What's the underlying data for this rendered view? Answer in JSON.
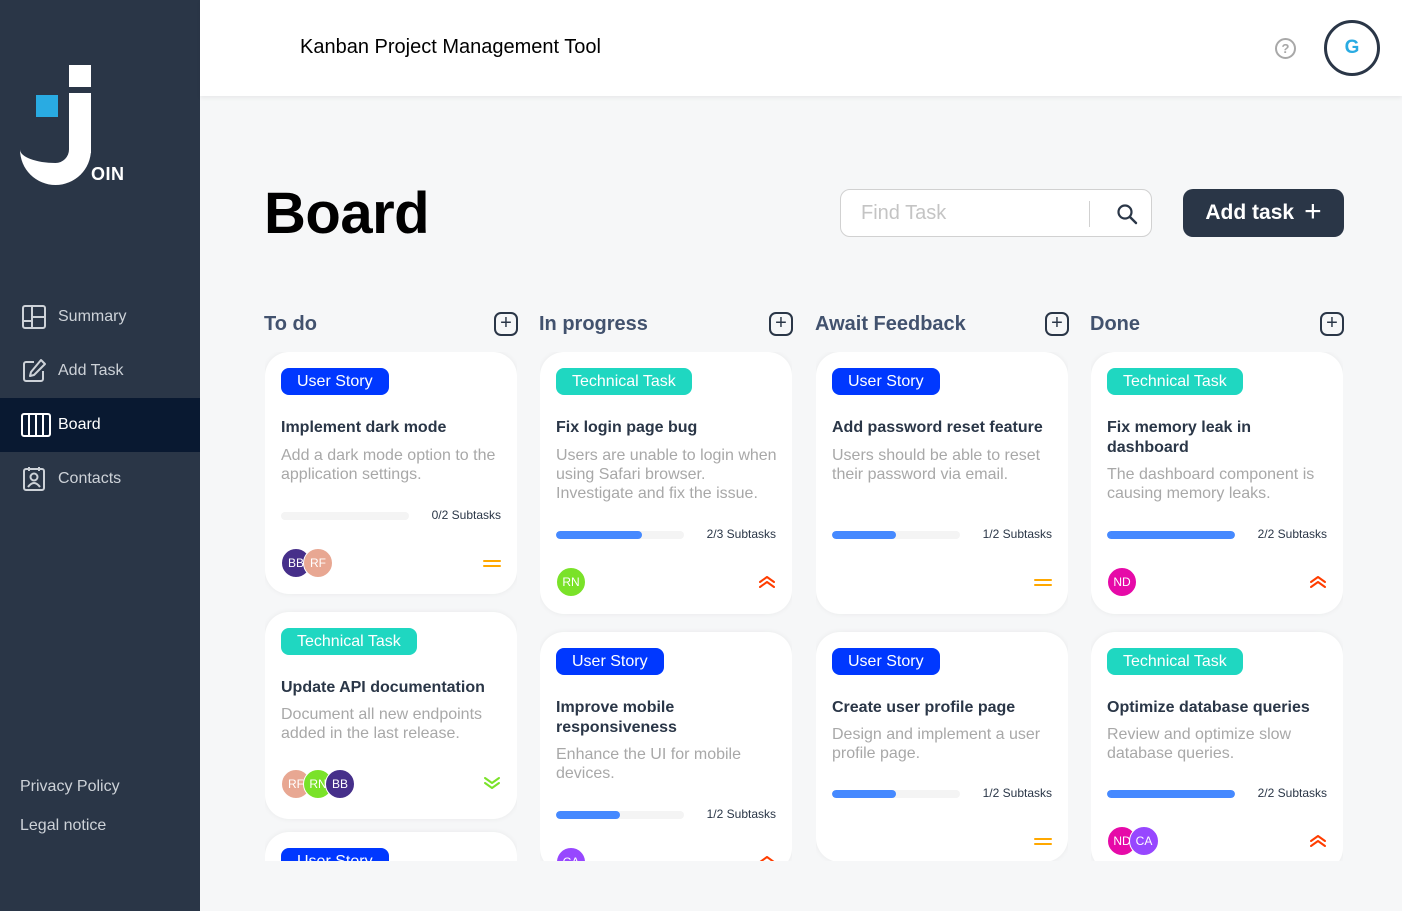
{
  "app": {
    "logo_text": "OIN",
    "header_title": "Kanban Project Management Tool",
    "help_icon": "?",
    "user_initial": "G"
  },
  "nav": [
    {
      "label": "Summary",
      "icon": "summary-icon"
    },
    {
      "label": "Add Task",
      "icon": "edit-icon"
    },
    {
      "label": "Board",
      "icon": "board-icon",
      "active": true
    },
    {
      "label": "Contacts",
      "icon": "contacts-icon"
    }
  ],
  "footer_links": [
    "Privacy Policy",
    "Legal notice"
  ],
  "board": {
    "title": "Board",
    "search_placeholder": "Find Task",
    "add_task_label": "Add task",
    "add_task_icon": "+"
  },
  "colors": {
    "sidebar": "#2a3647",
    "user_story": "#0038ff",
    "technical_task": "#1fd7c1",
    "progress": "#4589ff",
    "prio_medium": "#ffa800",
    "prio_urgent": "#ff3d00",
    "prio_low": "#7ae229"
  },
  "columns": [
    {
      "title": "To do",
      "add_icon": "+",
      "cards": [
        {
          "tag": "User Story",
          "type": "us",
          "title": "Implement dark mode",
          "desc": "Add a dark mode option to the application settings.",
          "progress": 0,
          "subtasks": "0/2 Subtasks",
          "avatars": [
            {
              "i": "BB",
              "c": "#462f8a"
            },
            {
              "i": "RF",
              "c": "#e8a792"
            }
          ],
          "prio": "medium"
        },
        {
          "tag": "Technical Task",
          "type": "tt",
          "title": "Update API documentation",
          "desc": "Document all new endpoints added in the last release.",
          "avatars": [
            {
              "i": "RF",
              "c": "#e8a792"
            },
            {
              "i": "RN",
              "c": "#7ae229"
            },
            {
              "i": "BB",
              "c": "#462f8a"
            }
          ],
          "prio": "low"
        },
        {
          "tag": "User Story",
          "type": "us",
          "title": "",
          "desc": "",
          "avatars": [],
          "prio": ""
        }
      ]
    },
    {
      "title": "In progress",
      "add_icon": "+",
      "cards": [
        {
          "tag": "Technical Task",
          "type": "tt",
          "title": "Fix login page bug",
          "desc": "Users are unable to login when using Safari browser. Investigate and fix the issue.",
          "progress": 0.667,
          "subtasks": "2/3 Subtasks",
          "avatars": [
            {
              "i": "RN",
              "c": "#7ae229"
            }
          ],
          "prio": "urgent"
        },
        {
          "tag": "User Story",
          "type": "us",
          "title": "Improve mobile responsiveness",
          "desc": "Enhance the UI for mobile devices.",
          "progress": 0.5,
          "subtasks": "1/2 Subtasks",
          "avatars": [
            {
              "i": "CA",
              "c": "#9747ff"
            }
          ],
          "prio": "urgent"
        }
      ]
    },
    {
      "title": "Await Feedback",
      "add_icon": "+",
      "cards": [
        {
          "tag": "User Story",
          "type": "us",
          "title": "Add password reset feature",
          "desc": "Users should be able to reset their password via email.",
          "progress": 0.5,
          "subtasks": "1/2 Subtasks",
          "avatars": [],
          "prio": "medium"
        },
        {
          "tag": "User Story",
          "type": "us",
          "title": "Create user profile page",
          "desc": "Design and implement a user profile page.",
          "progress": 0.5,
          "subtasks": "1/2 Subtasks",
          "avatars": [],
          "prio": "medium"
        }
      ]
    },
    {
      "title": "Done",
      "add_icon": "+",
      "cards": [
        {
          "tag": "Technical Task",
          "type": "tt",
          "title": "Fix memory leak in dashboard",
          "desc": "The dashboard component is causing memory leaks.",
          "progress": 1,
          "subtasks": "2/2 Subtasks",
          "avatars": [
            {
              "i": "ND",
              "c": "#e60aa8"
            }
          ],
          "prio": "urgent"
        },
        {
          "tag": "Technical Task",
          "type": "tt",
          "title": "Optimize database queries",
          "desc": "Review and optimize slow database queries.",
          "progress": 1,
          "subtasks": "2/2 Subtasks",
          "avatars": [
            {
              "i": "ND",
              "c": "#e60aa8"
            },
            {
              "i": "CA",
              "c": "#9747ff"
            }
          ],
          "prio": "urgent"
        }
      ]
    }
  ]
}
